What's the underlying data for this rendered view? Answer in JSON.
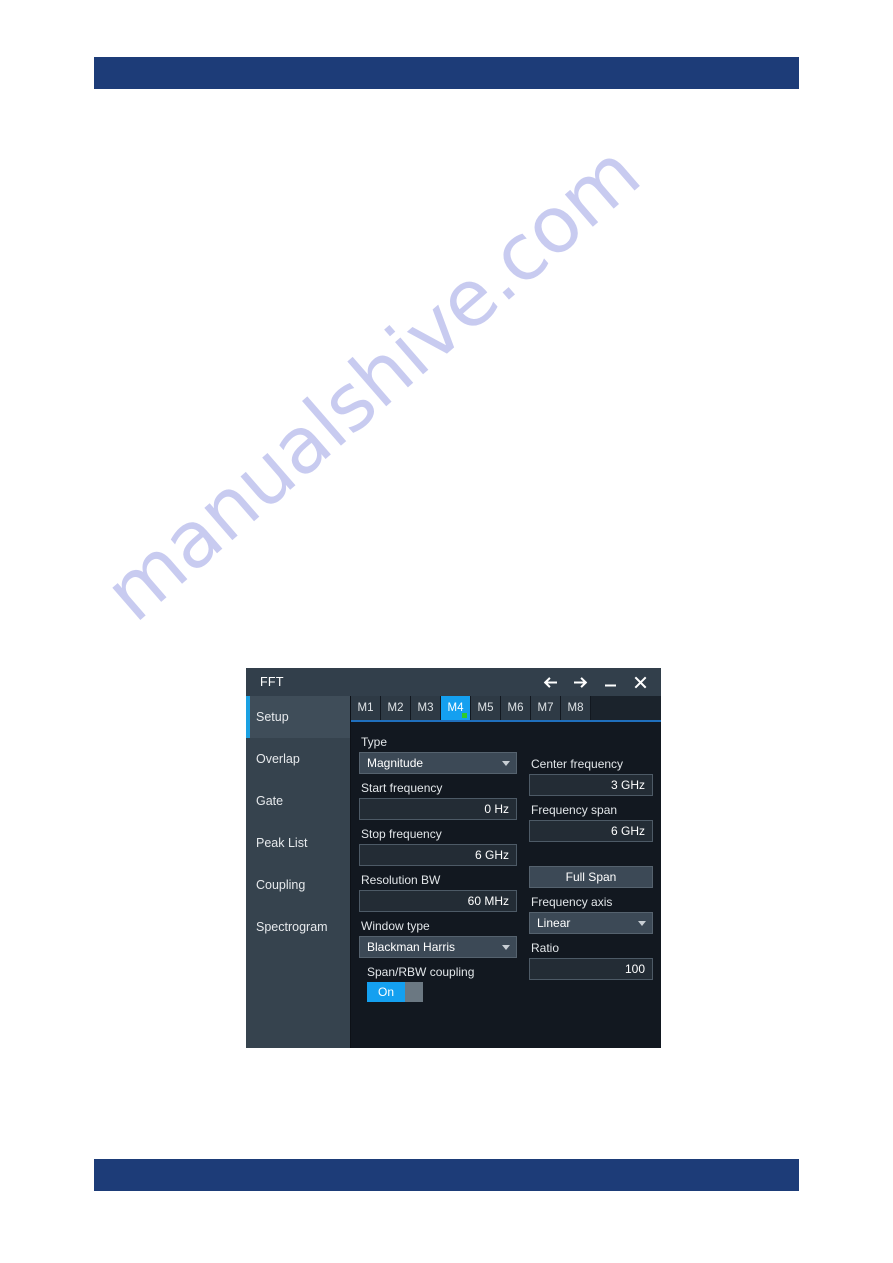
{
  "watermark": {
    "text": "manualshive.com"
  },
  "dialog": {
    "title": "FFT",
    "titlebar_icons": [
      {
        "name": "back-arrow-icon",
        "glyph": "left-arrow"
      },
      {
        "name": "forward-arrow-icon",
        "glyph": "right-arrow"
      },
      {
        "name": "minimize-icon",
        "glyph": "minus"
      },
      {
        "name": "close-icon",
        "glyph": "cross"
      }
    ],
    "sidebar": {
      "items": [
        {
          "label": "Setup",
          "active": true
        },
        {
          "label": "Overlap",
          "active": false
        },
        {
          "label": "Gate",
          "active": false
        },
        {
          "label": "Peak List",
          "active": false
        },
        {
          "label": "Coupling",
          "active": false
        },
        {
          "label": "Spectrogram",
          "active": false
        }
      ]
    },
    "tabs": [
      {
        "label": "M1",
        "active": false
      },
      {
        "label": "M2",
        "active": false
      },
      {
        "label": "M3",
        "active": false
      },
      {
        "label": "M4",
        "active": true
      },
      {
        "label": "M5",
        "active": false
      },
      {
        "label": "M6",
        "active": false
      },
      {
        "label": "M7",
        "active": false
      },
      {
        "label": "M8",
        "active": false
      }
    ],
    "form": {
      "type": {
        "label": "Type",
        "value": "Magnitude"
      },
      "start_frequency": {
        "label": "Start frequency",
        "value": "0 Hz"
      },
      "stop_frequency": {
        "label": "Stop frequency",
        "value": "6 GHz"
      },
      "resolution_bw": {
        "label": "Resolution BW",
        "value": "60 MHz"
      },
      "window_type": {
        "label": "Window type",
        "value": "Blackman Harris"
      },
      "span_rbw_coupling": {
        "label": "Span/RBW coupling",
        "value": "On"
      },
      "center_frequency": {
        "label": "Center frequency",
        "value": "3 GHz"
      },
      "frequency_span": {
        "label": "Frequency span",
        "value": "6 GHz"
      },
      "full_span_button": {
        "label": "Full Span"
      },
      "frequency_axis": {
        "label": "Frequency axis",
        "value": "Linear"
      },
      "ratio": {
        "label": "Ratio",
        "value": "100"
      }
    }
  },
  "colors": {
    "page_bar": "#1d3c78",
    "accent_blue": "#14a0f0",
    "sidebar_bg": "#36434e",
    "panel_bg": "#121820",
    "titlebar_bg": "#323f4b",
    "status_dot_green": "#2ecc2e",
    "watermark": "#b9bdec"
  }
}
